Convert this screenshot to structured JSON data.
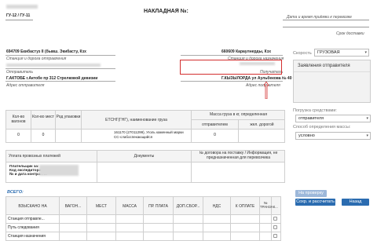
{
  "header": {
    "blurred_top": "...",
    "form_code": "ГУ-12 / ГУ-11",
    "title": "НАКЛАДНАЯ №:",
    "date_label": "Дата и время приёмки к перевозке",
    "delivery_label": "Срок доставки"
  },
  "route": {
    "departure_station": "694709 Екибастуз II (бывш. Экибасту, Кзх",
    "departure_label": "Станция и дорога отправления",
    "destination_station": "660609 Караулнерды, Кзх",
    "destination_label": "Станция и дорога назначения",
    "sender_label": "Отправитель",
    "sender_value": "Г.АКТОБЕ г.Актобе пр 312 Стрелковой девизии",
    "sender_address_label": "Адрес отправителя",
    "receiver_label": "Получатель",
    "receiver_value": "Г.КЫЗЫЛОРДА ул Аульбекова № 40",
    "receiver_address_label": "Адрес получателя"
  },
  "sidebar": {
    "speed_label": "Скорость",
    "speed_value": "ГРУЗОВАЯ",
    "sender_statement": "Заявления отправителя",
    "transport_label": "Погрузка средствами:",
    "transport_value": "отправителя",
    "mass_label": "Способ определения массы:",
    "mass_value": "условно"
  },
  "cargo_table": {
    "headers": [
      "Кол-во вагонов",
      "Кол-во мест",
      "Род упаковки",
      "ЕТСНГ(ГНГ), наименование груза",
      "Масса груза в кг, определенная",
      "отправителем",
      "жел. дорогой"
    ],
    "row": {
      "wagons": "0",
      "places": "0",
      "description": "161170 (27011299), Уголь каменный марки СС-слабоспекающийся",
      "mass_sender": "0",
      "mass_rail": ""
    }
  },
  "payments": {
    "header": "Уплата провозных платежей",
    "docs_header": "Документы",
    "contract_header": "№ договора на поставку / Информация, не предназначенная для перевозчика",
    "payer_label": "Плательщик за:",
    "forwarder_label": "Код экспедитора:",
    "contract_label": "№ и дата контракта:"
  },
  "buttons": {
    "check": "На проверку",
    "save": "Сохр. и рассчитать",
    "back": "Назад"
  },
  "totals": {
    "title": "ВСЕГО:",
    "headers": [
      "ВЗЫСКАНО НА",
      "ВАГОН...",
      "МЕСТ",
      "МАССА",
      "ПР. ПЛАТА",
      "ДОП.СБОР...",
      "НДС",
      "К ОПЛАТЕ",
      "№ ТРАНЗАК..."
    ],
    "rows": [
      "Станция отправле...",
      "Путь следования",
      "Станция назначения"
    ]
  },
  "colors": {
    "highlight": "#d32f2f",
    "button_blue": "#2b6cb0",
    "button_disabled": "#9db8da",
    "sidebar_bg": "#f2f2f2"
  }
}
